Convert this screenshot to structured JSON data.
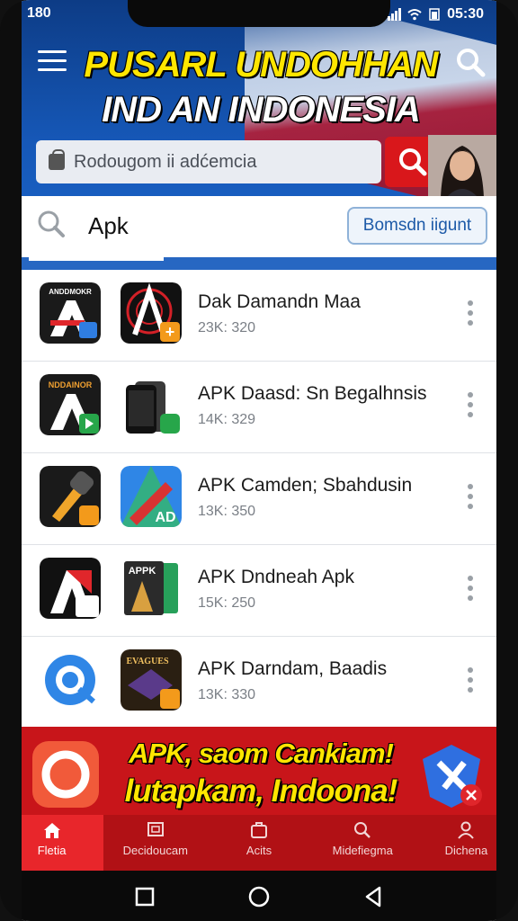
{
  "status": {
    "left_text": "180",
    "time": "05:30"
  },
  "header": {
    "title_line1": "PUSARL UNDOHHAN",
    "title_line2": "IND AN INDONESIA",
    "search_placeholder": "Rodougom ii adćemcia"
  },
  "search_row": {
    "query": "Apk",
    "button_label": "Bomsdn iigunt"
  },
  "items": [
    {
      "title": "Dak Damandn Maa",
      "meta": "23K: 320",
      "icon1_text": "ANDDMOKR",
      "icon2_text": ""
    },
    {
      "title": "APK Daasd: Sn Begalhnsis",
      "meta": "14K: 329",
      "icon1_text": "NDDAINOR",
      "icon2_text": ""
    },
    {
      "title": "APK Camden; Sbahdusin",
      "meta": "13K: 350",
      "icon1_text": "",
      "icon2_text": "AD"
    },
    {
      "title": "APK Dndneah Apk",
      "meta": "15K: 250",
      "icon1_text": "",
      "icon2_text": "APPK"
    },
    {
      "title": "APK Darndam, Baadis",
      "meta": "13K: 330",
      "icon1_text": "",
      "icon2_text": "EVAGUES"
    }
  ],
  "promo": {
    "line1": "APK, saom Cankiam!",
    "line2": "lutapkam, Indoona!"
  },
  "nav": {
    "items": [
      {
        "label": "Fletia",
        "icon": "home-icon"
      },
      {
        "label": "Decidoucam",
        "icon": "screen-icon"
      },
      {
        "label": "Acits",
        "icon": "briefcase-icon"
      },
      {
        "label": "Midefiegma",
        "icon": "search-icon"
      },
      {
        "label": "Dichena",
        "icon": "user-icon"
      }
    ]
  },
  "colors": {
    "header_blue": "#1658b8",
    "accent_red": "#d9171b",
    "title_yellow": "#ffe600"
  }
}
